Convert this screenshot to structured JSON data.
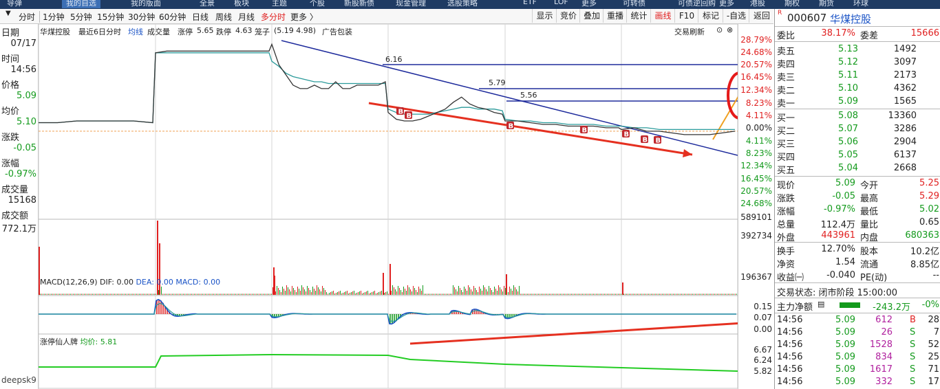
{
  "top_nav": [
    "导弹",
    "我的自选",
    "我的版面",
    "全景",
    "板块",
    "主题",
    "个股",
    "新股新债",
    "现金管理",
    "选股策略",
    "ETF",
    "LOF",
    "更多",
    "可转债",
    "可债逆回购",
    "更多",
    "港股",
    "期权",
    "期货",
    "环球"
  ],
  "periods": {
    "items": [
      "分时",
      "1分钟",
      "5分钟",
      "15分钟",
      "30分钟",
      "60分钟",
      "日线",
      "周线",
      "月线",
      "多分时",
      "更多 〉"
    ],
    "active": "多分时"
  },
  "toolbar": [
    "显示",
    "竞价",
    "叠加",
    "重播",
    "统计",
    "画线",
    "F10",
    "标记",
    "-自选",
    "返回"
  ],
  "toolbar_active": "画线",
  "left_info": {
    "date_label": "日期",
    "date": "07/17",
    "time_label": "时间",
    "time": "14:56",
    "price_label": "价格",
    "price": "5.09",
    "avg_label": "均价",
    "avg": "5.10",
    "chg_label": "涨跌",
    "chg": "-0.05",
    "pct_label": "涨幅",
    "pct": "-0.97%",
    "vol_label": "成交量",
    "vol": "15168",
    "amt_label": "成交额",
    "amt": "772.1万",
    "footer": "deepsk9"
  },
  "chart_header": {
    "name": "华煤控股",
    "mode": "最近6日分时",
    "avg_label": "均线",
    "vol_label": "成交量",
    "limit_up_label": "涨停",
    "limit_up": "5.65",
    "limit_down_label": "跌停",
    "limit_down": "4.63",
    "cage_label": "笼子",
    "cage": "(5.19 4.98)",
    "ad": "广告包装",
    "refresh": "交易刷新"
  },
  "price_scale": [
    "28.79%",
    "24.68%",
    "20.57%",
    "16.45%",
    "12.34%",
    "8.23%",
    "4.11%",
    "0.00%",
    "4.11%",
    "8.23%",
    "12.34%",
    "16.45%",
    "20.57%",
    "24.68%"
  ],
  "volume_scale": [
    "589101",
    "392734",
    "196367"
  ],
  "macd": {
    "title": "MACD(12,26,9)",
    "dif_label": "DIF:",
    "dif": "0.00",
    "dea_label": "DEA:",
    "dea": "0.00",
    "macd_label": "MACD:",
    "macd": "0.00",
    "scale": [
      "0.15",
      "0.07",
      "0.00"
    ]
  },
  "indicator2": {
    "title": "涨停仙人牌",
    "value_label": "均价:",
    "value": "5.81",
    "scale": [
      "6.67",
      "6.24",
      "5.82"
    ]
  },
  "annotations": {
    "levels": [
      "6.16",
      "5.79",
      "5.56"
    ],
    "buy_marker": "B"
  },
  "chart_data": {
    "type": "line",
    "price_series": [
      5.14,
      5.14,
      5.15,
      5.15,
      5.15,
      5.15,
      5.14,
      5.55,
      5.56,
      5.56,
      5.56,
      5.56,
      5.56,
      5.56,
      5.56,
      5.56,
      5.56,
      5.56,
      5.6,
      5.48,
      5.42,
      5.36,
      5.34,
      5.34,
      5.36,
      5.34,
      5.34,
      5.38,
      5.34,
      5.34,
      5.36,
      5.36,
      5.36,
      5.36,
      5.38,
      5.2,
      5.16,
      5.15,
      5.15,
      5.16,
      5.18,
      5.2,
      5.22,
      5.26,
      5.29,
      5.25,
      5.23,
      5.22,
      5.2,
      5.19,
      5.15,
      5.15,
      5.14,
      5.13,
      5.13,
      5.12,
      5.12,
      5.12,
      5.11,
      5.11,
      5.1,
      5.11,
      5.09,
      5.09,
      5.08,
      5.07,
      5.07,
      5.07,
      5.08,
      5.09
    ],
    "avg_series": [
      5.14,
      5.14,
      5.15,
      5.15,
      5.15,
      5.15,
      5.14,
      5.55,
      5.55,
      5.55,
      5.55,
      5.55,
      5.55,
      5.55,
      5.55,
      5.55,
      5.55,
      5.55,
      5.5,
      5.47,
      5.43,
      5.41,
      5.4,
      5.39,
      5.38,
      5.38,
      5.37,
      5.37,
      5.37,
      5.37,
      5.37,
      5.37,
      5.37,
      5.37,
      5.37,
      5.22,
      5.2,
      5.19,
      5.19,
      5.19,
      5.19,
      5.2,
      5.21,
      5.22,
      5.23,
      5.23,
      5.22,
      5.22,
      5.22,
      5.21,
      5.16,
      5.15,
      5.15,
      5.14,
      5.14,
      5.13,
      5.13,
      5.13,
      5.12,
      5.12,
      5.12,
      5.11,
      5.11,
      5.1,
      5.1,
      5.1,
      5.1,
      5.1,
      5.1,
      5.1
    ],
    "ylim": [
      4.63,
      5.65
    ],
    "base": 5.14
  },
  "right_panel": {
    "code": "000607",
    "name": "华煤控股",
    "badge": "R",
    "webi_label": "委比",
    "webi": "38.17%",
    "weicha_label": "委差",
    "weicha": "15666",
    "asks": [
      {
        "label": "卖五",
        "price": "5.13",
        "vol": "1492"
      },
      {
        "label": "卖四",
        "price": "5.12",
        "vol": "3097"
      },
      {
        "label": "卖三",
        "price": "5.11",
        "vol": "2173"
      },
      {
        "label": "卖二",
        "price": "5.10",
        "vol": "4362"
      },
      {
        "label": "卖一",
        "price": "5.09",
        "vol": "1565"
      }
    ],
    "bids": [
      {
        "label": "买一",
        "price": "5.08",
        "vol": "13360"
      },
      {
        "label": "买二",
        "price": "5.07",
        "vol": "3286"
      },
      {
        "label": "买三",
        "price": "5.06",
        "vol": "2904"
      },
      {
        "label": "买四",
        "price": "5.05",
        "vol": "6137"
      },
      {
        "label": "买五",
        "price": "5.04",
        "vol": "2668"
      }
    ],
    "stats": [
      {
        "l1": "现价",
        "v1": "5.09",
        "l2": "今开",
        "v2": "5.25"
      },
      {
        "l1": "涨跌",
        "v1": "-0.05",
        "l2": "最高",
        "v2": "5.29"
      },
      {
        "l1": "涨幅",
        "v1": "-0.97%",
        "l2": "最低",
        "v2": "5.02"
      },
      {
        "l1": "总量",
        "v1": "112.4万",
        "l2": "量比",
        "v2": "0.65"
      },
      {
        "l1": "外盘",
        "v1": "443961",
        "l2": "内盘",
        "v2": "680363"
      }
    ],
    "stats2": [
      {
        "l1": "换手",
        "v1": "12.70%",
        "l2": "股本",
        "v2": "10.2亿"
      },
      {
        "l1": "净资",
        "v1": "1.54",
        "l2": "流通",
        "v2": "8.85亿"
      },
      {
        "l1": "收益㈠",
        "v1": "-0.040",
        "l2": "PE(动)",
        "v2": "--"
      }
    ],
    "trade_status": "交易状态: 闭市阶段 15:00:00",
    "main_flow_label": "主力净额",
    "main_flow_value": "-243.2万",
    "main_flow_pct": "-0%",
    "ticks": [
      {
        "time": "14:56",
        "price": "5.09",
        "vol": "612",
        "side": "B",
        "n": "28"
      },
      {
        "time": "14:56",
        "price": "5.09",
        "vol": "26",
        "side": "S",
        "n": "7"
      },
      {
        "time": "14:56",
        "price": "5.09",
        "vol": "1528",
        "side": "S",
        "n": "52"
      },
      {
        "time": "14:56",
        "price": "5.09",
        "vol": "834",
        "side": "S",
        "n": "25"
      },
      {
        "time": "14:56",
        "price": "5.09",
        "vol": "1617",
        "side": "S",
        "n": "71"
      },
      {
        "time": "14:56",
        "price": "5.09",
        "vol": "332",
        "side": "S",
        "n": "17"
      }
    ]
  }
}
